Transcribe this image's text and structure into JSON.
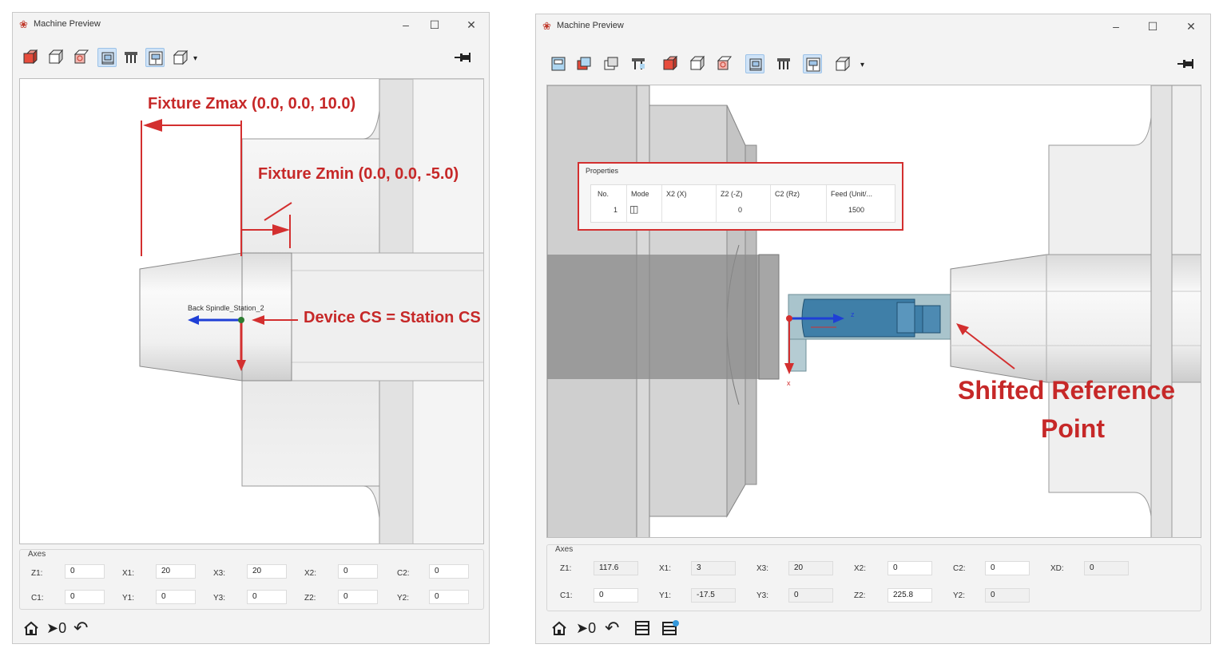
{
  "windows": [
    {
      "title": "Machine Preview",
      "viewport_label": "Back Spindle_Station_2",
      "annotations": {
        "zmax": "Fixture Zmax (0.0, 0.0, 10.0)",
        "zmin": "Fixture Zmin (0.0, 0.0, -5.0)",
        "device_cs": "Device CS = Station CS"
      },
      "axes": {
        "title": "Axes",
        "rows": [
          [
            {
              "label": "Z1:",
              "value": "0"
            },
            {
              "label": "X1:",
              "value": "20"
            },
            {
              "label": "X3:",
              "value": "20"
            },
            {
              "label": "X2:",
              "value": "0"
            },
            {
              "label": "C2:",
              "value": "0"
            }
          ],
          [
            {
              "label": "C1:",
              "value": "0"
            },
            {
              "label": "Y1:",
              "value": "0"
            },
            {
              "label": "Y3:",
              "value": "0"
            },
            {
              "label": "Z2:",
              "value": "0"
            },
            {
              "label": "Y2:",
              "value": "0"
            }
          ]
        ]
      },
      "bottom": {
        "zero_label": "0"
      }
    },
    {
      "title": "Machine Preview",
      "axis_labels": {
        "z": "z",
        "x": "x"
      },
      "annotations": {
        "shifted": [
          "Shifted Reference",
          "Point"
        ]
      },
      "properties": {
        "title": "Properties",
        "columns": [
          "No.",
          "Mode",
          "X2 (X)",
          "Z2 (-Z)",
          "C2 (Rz)",
          "Feed (Unit/..."
        ],
        "rows": [
          [
            "1",
            "",
            "",
            "0",
            "",
            "1500"
          ]
        ]
      },
      "axes": {
        "title": "Axes",
        "rows": [
          [
            {
              "label": "Z1:",
              "value": "117.6"
            },
            {
              "label": "X1:",
              "value": "3"
            },
            {
              "label": "X3:",
              "value": "20"
            },
            {
              "label": "X2:",
              "value": "0"
            },
            {
              "label": "C2:",
              "value": "0"
            },
            {
              "label": "XD:",
              "value": "0"
            }
          ],
          [
            {
              "label": "C1:",
              "value": "0"
            },
            {
              "label": "Y1:",
              "value": "-17.5"
            },
            {
              "label": "Y3:",
              "value": "0"
            },
            {
              "label": "Z2:",
              "value": "225.8"
            },
            {
              "label": "Y2:",
              "value": "0"
            }
          ]
        ]
      },
      "bottom": {
        "zero_label": "0"
      }
    }
  ]
}
